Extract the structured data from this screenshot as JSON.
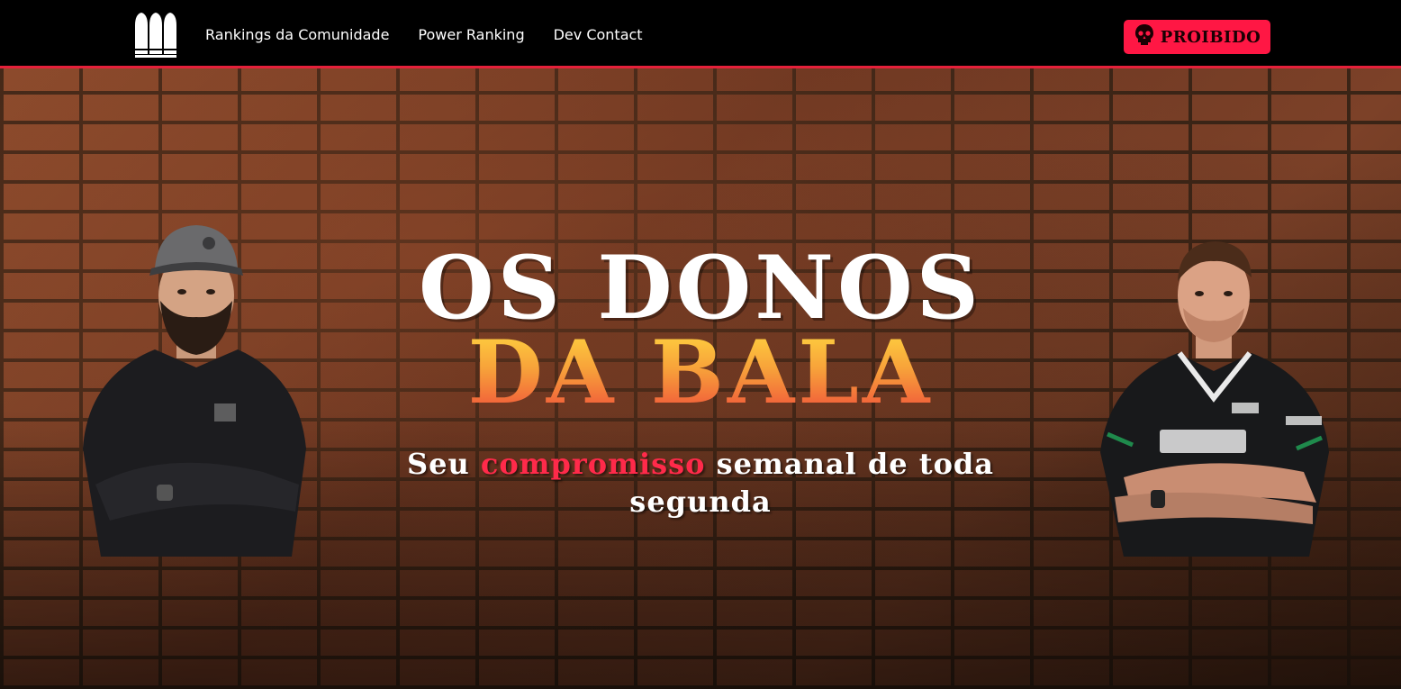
{
  "navbar": {
    "logo": "bullets-logo-icon",
    "links": [
      {
        "label": "Rankings da Comunidade"
      },
      {
        "label": "Power Ranking"
      },
      {
        "label": "Dev Contact"
      }
    ],
    "cta": {
      "label": "PROIBIDO",
      "icon": "skull-icon",
      "color": "#ff1744"
    },
    "accent_color": "#e5203a"
  },
  "hero": {
    "title_line1": "OS DONOS",
    "title_line2": "DA BALA",
    "subtitle_prefix": "Seu ",
    "subtitle_accent": "compromisso",
    "subtitle_suffix": " semanal de toda segunda",
    "accent_color": "#ff2a4a",
    "title_gradient": [
      "#ffd23f",
      "#f7a23a",
      "#f0503a"
    ]
  }
}
